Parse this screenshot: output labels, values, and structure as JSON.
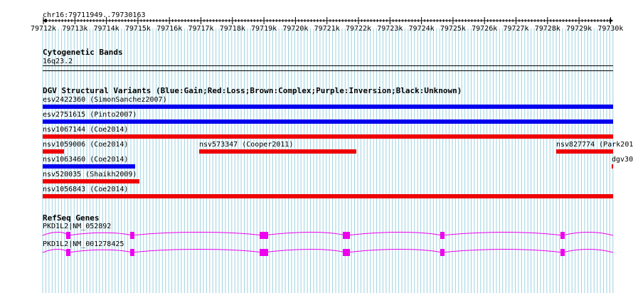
{
  "location": "chr16:79711949..79730163",
  "ruler_ticks": [
    "79712k",
    "79713k",
    "79714k",
    "79715k",
    "79716k",
    "79717k",
    "79718k",
    "79719k",
    "79720k",
    "79721k",
    "79722k",
    "79723k",
    "79724k",
    "79725k",
    "79726k",
    "79727k",
    "79728k",
    "79729k",
    "79730k"
  ],
  "tracks": {
    "cytoband": {
      "title": "Cytogenetic Bands",
      "band": "16q23.2"
    },
    "dgv": {
      "title": "DGV Structural Variants (Blue:Gain;Red:Loss;Brown:Complex;Purple:Inversion;Black:Unknown)",
      "variants": [
        {
          "label": "esv2422360 (SimonSanchez2007)",
          "type": "gain"
        },
        {
          "label": "esv2751615 (Pinto2007)",
          "type": "gain"
        },
        {
          "label": "nsv1067144 (Coe2014)",
          "type": "loss"
        },
        {
          "label": "nsv1059006 (Coe2014)",
          "type": "loss"
        },
        {
          "label": "nsv573347 (Cooper2011)",
          "type": "loss"
        },
        {
          "label": "nsv827774 (Park201",
          "type": "loss"
        },
        {
          "label": "nsv1063460 (Coe2014)",
          "type": "gain"
        },
        {
          "label": "dgv30",
          "type": "loss"
        },
        {
          "label": "nsv520035 (Shaikh2009)",
          "type": "loss"
        },
        {
          "label": "nsv1056843 (Coe2014)",
          "type": "loss"
        }
      ]
    },
    "refseq": {
      "title": "RefSeq Genes",
      "transcripts": [
        {
          "label": "PKD1L2|NM_052892"
        },
        {
          "label": "PKD1L2|NM_001278425"
        }
      ]
    }
  },
  "colors": {
    "gain": "#0000ee",
    "loss": "#ee0000",
    "gene": "#ee00ee",
    "grid": "#9cd2e0"
  }
}
